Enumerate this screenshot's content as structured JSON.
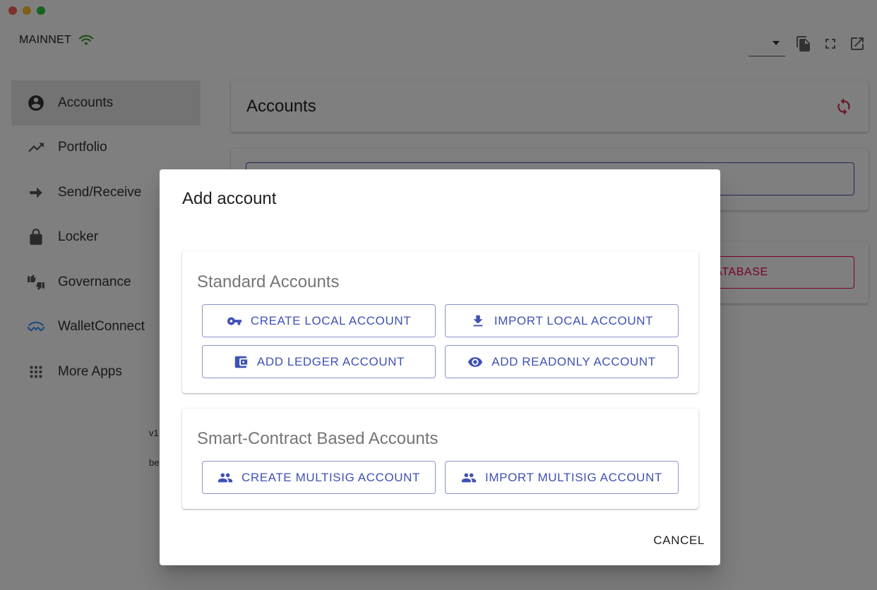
{
  "network": {
    "label": "MAINNET"
  },
  "sidebar": {
    "items": [
      {
        "label": "Accounts",
        "icon": "account-circle-icon",
        "active": true
      },
      {
        "label": "Portfolio",
        "icon": "trending-up-icon"
      },
      {
        "label": "Send/Receive",
        "icon": "arrow-right-icon"
      },
      {
        "label": "Locker",
        "icon": "lock-icon"
      },
      {
        "label": "Governance",
        "icon": "thumbs-icon"
      },
      {
        "label": "WalletConnect",
        "icon": "walletconnect-icon"
      },
      {
        "label": "More Apps",
        "icon": "apps-grid-icon"
      }
    ],
    "version_fragment": "v1",
    "build_fragment": "be"
  },
  "main": {
    "header_title": "Accounts",
    "db_button_fragment": "ATABASE"
  },
  "dialog": {
    "title": "Add account",
    "standard": {
      "title": "Standard Accounts",
      "create_local": "CREATE LOCAL ACCOUNT",
      "import_local": "IMPORT LOCAL ACCOUNT",
      "add_ledger": "ADD LEDGER ACCOUNT",
      "add_readonly": "ADD READONLY ACCOUNT"
    },
    "smart_contract": {
      "title": "Smart-Contract Based Accounts",
      "create_multisig": "CREATE MULTISIG ACCOUNT",
      "import_multisig": "IMPORT MULTISIG ACCOUNT"
    },
    "cancel_label": "CANCEL"
  },
  "colors": {
    "primary": "#3f51b5",
    "secondary": "#f50057",
    "wifi": "#3d9a2b",
    "refresh": "#e0244b"
  }
}
